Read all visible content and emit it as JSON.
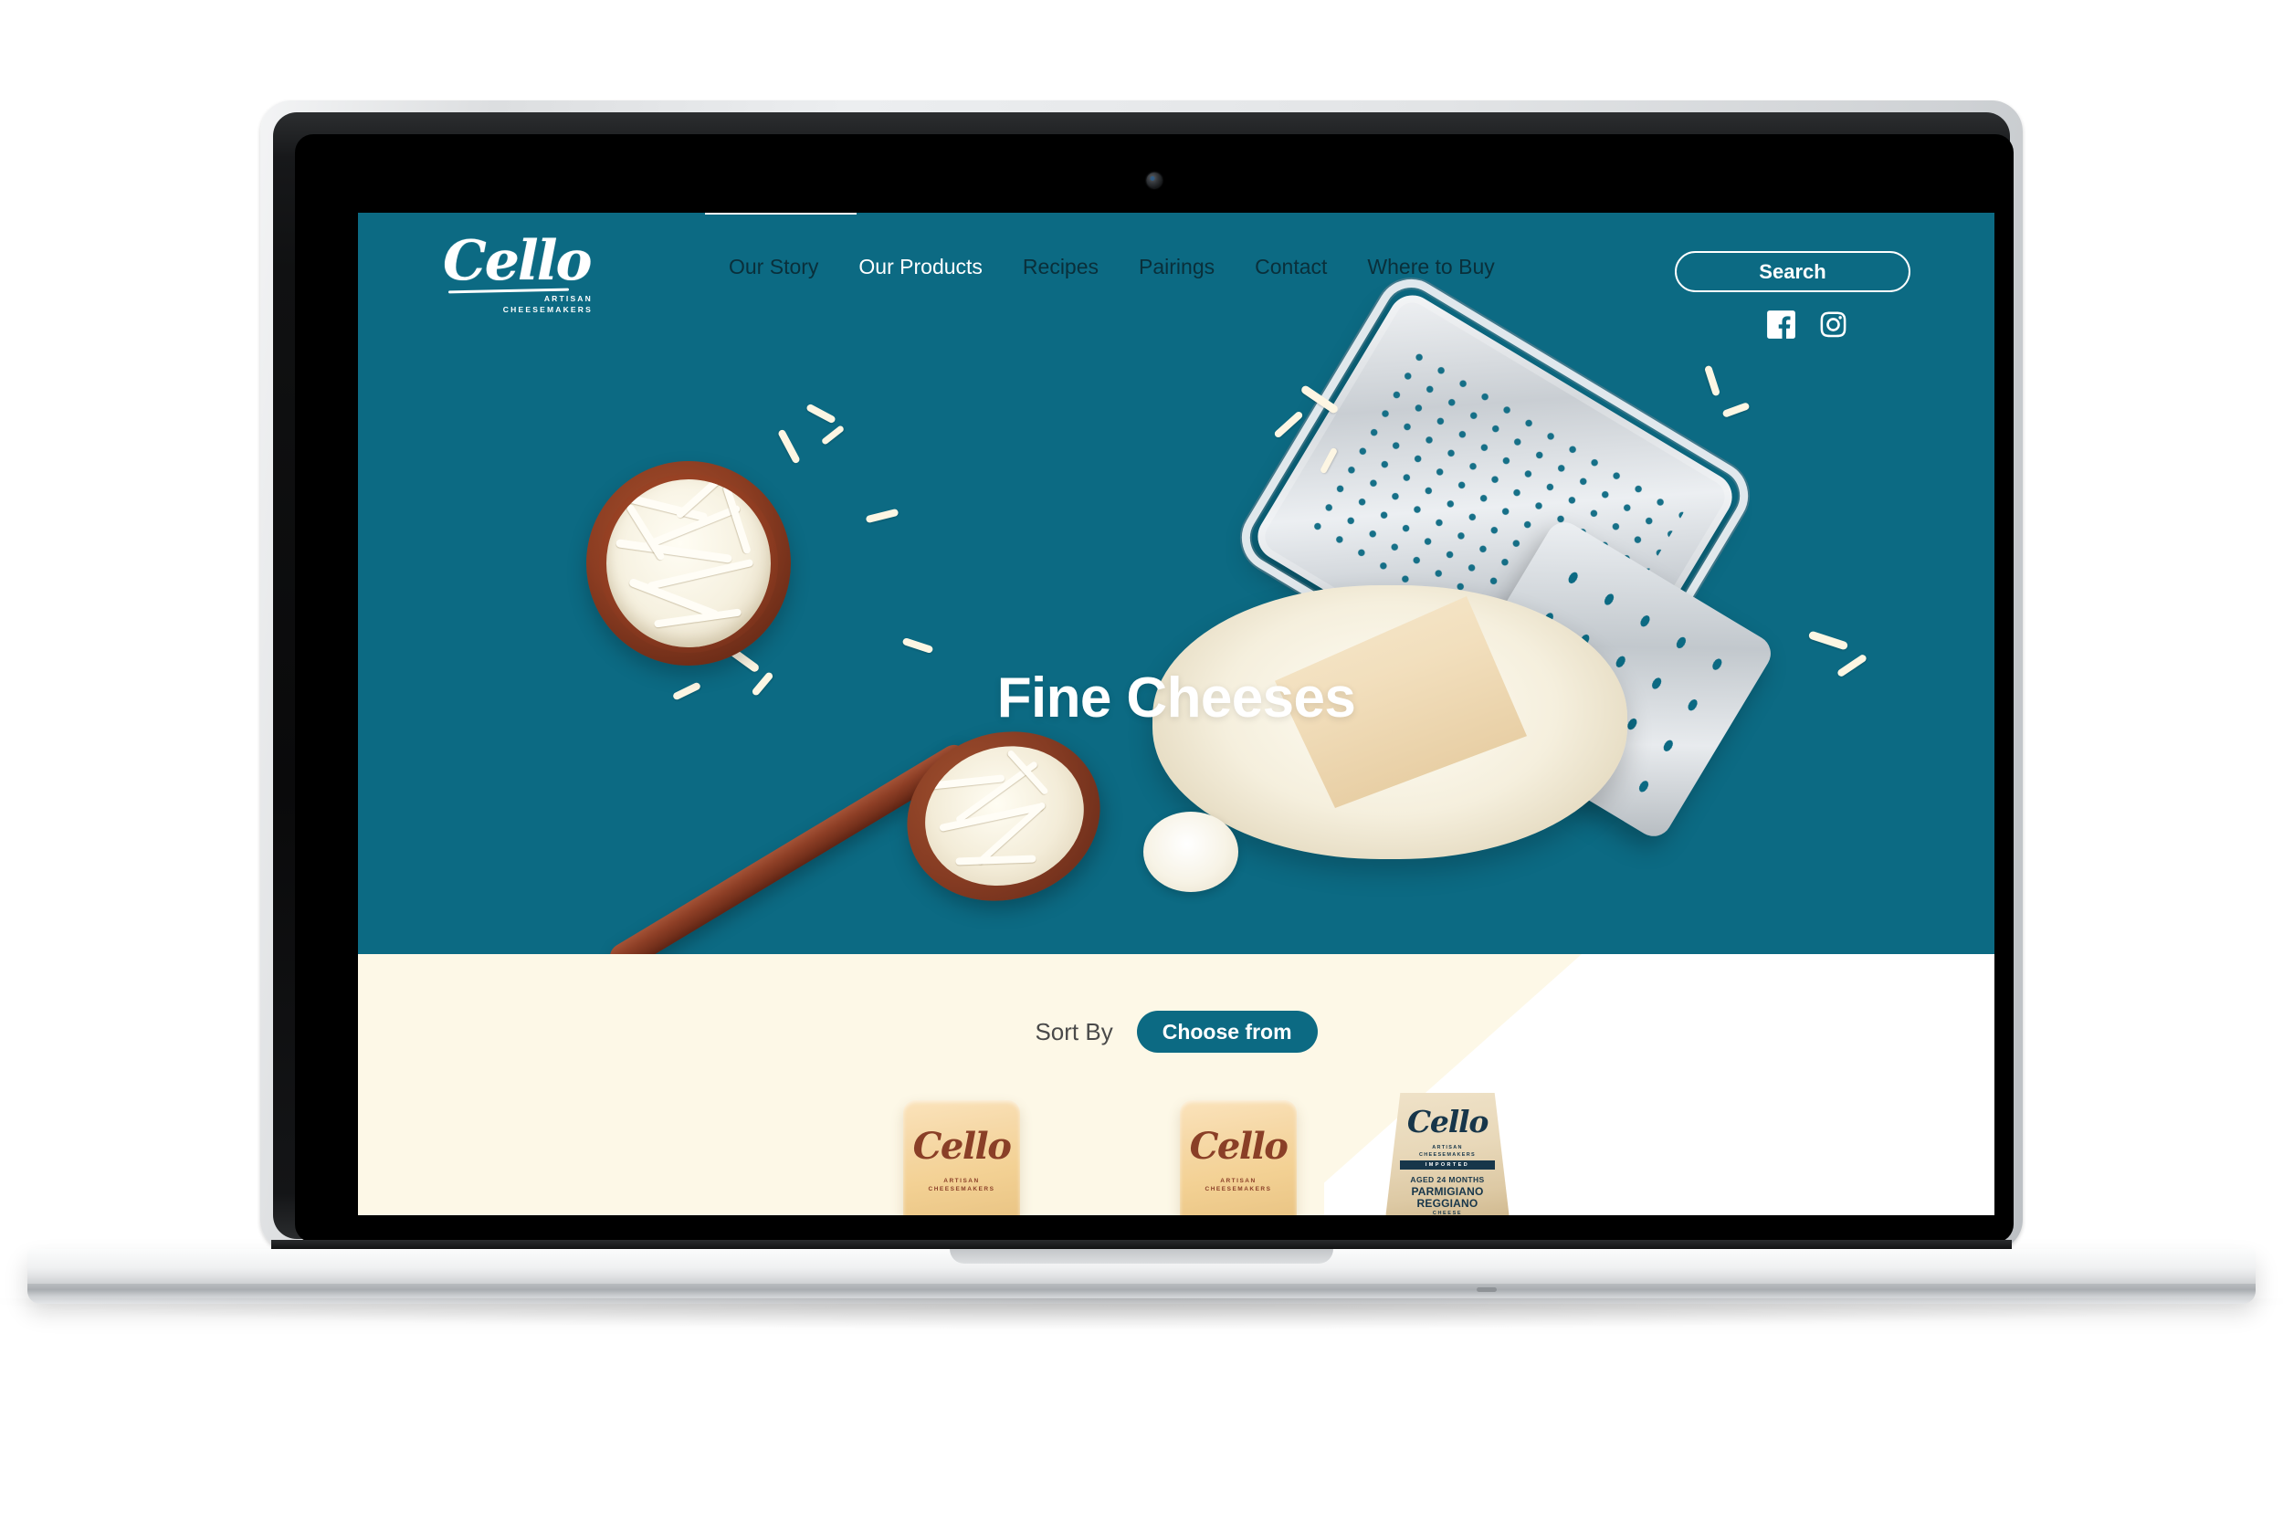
{
  "device": {
    "type": "laptop",
    "frame_color": "#dcdee0"
  },
  "site": {
    "brand": {
      "name": "Cello",
      "tagline_line1": "ARTISAN",
      "tagline_line2": "CHEESEMAKERS"
    },
    "colors": {
      "teal": "#0c6a83",
      "cream": "#fdf8e7",
      "white": "#ffffff",
      "nav_inactive": "#0a2f3a"
    },
    "nav": {
      "items": [
        {
          "label": "Our Story",
          "active": false
        },
        {
          "label": "Our Products",
          "active": true
        },
        {
          "label": "Recipes",
          "active": false
        },
        {
          "label": "Pairings",
          "active": false
        },
        {
          "label": "Contact",
          "active": false
        },
        {
          "label": "Where to Buy",
          "active": false
        }
      ],
      "dropdown_open_for": "Our Products"
    },
    "search": {
      "label": "Search"
    },
    "socials": [
      {
        "name": "facebook-icon",
        "label": "Facebook"
      },
      {
        "name": "instagram-icon",
        "label": "Instagram"
      }
    ],
    "hero": {
      "title": "Fine Cheeses",
      "imagery": [
        "wooden bowl of shredded mozzarella",
        "wooden spoon with shredded cheese",
        "stainless steel box grater",
        "cheese wedge on bed of shredded cheese",
        "scattered cheese shreds"
      ]
    },
    "sort": {
      "label": "Sort By",
      "selected": "Choose from"
    },
    "products": [
      {
        "id": "product-1",
        "pack": "block",
        "brand": "Cello",
        "tagline_line1": "ARTISAN",
        "tagline_line2": "CHEESEMAKERS"
      },
      {
        "id": "product-2",
        "pack": "block",
        "brand": "Cello",
        "tagline_line1": "ARTISAN",
        "tagline_line2": "CHEESEMAKERS"
      },
      {
        "id": "product-3",
        "pack": "wedge",
        "brand": "Cello",
        "tagline_line1": "ARTISAN",
        "tagline_line2": "CHEESEMAKERS",
        "banner": "IMPORTED",
        "aged": "AGED 24 MONTHS",
        "name_line1": "PARMIGIANO",
        "name_line2": "REGGIANO",
        "type": "CHEESE"
      }
    ]
  }
}
